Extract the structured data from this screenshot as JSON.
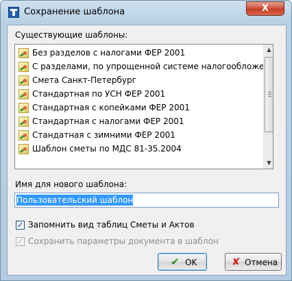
{
  "window": {
    "title": "Сохранение шаблона",
    "close_label": "X"
  },
  "templates_label": "Существующие шаблоны:",
  "templates": [
    "Без разделов с налогами ФЕР 2001",
    "С разделами, по упрощенной системе налогообложения",
    "Смета Санкт-Петербург",
    "Стандартная по УСН ФЕР 2001",
    "Стандартная с копейками ФЕР 2001",
    "Стандартная с налогами ФЕР 2001",
    "Стандатная с зимними ФЕР 2001",
    "Шаблон сметы по МДС 81-35.2004"
  ],
  "item_icon": "template-file-icon",
  "new_name_label": "Имя для нового шаблона:",
  "new_name_value": "Пользовательский шаблон",
  "checkboxes": {
    "remember": {
      "label": "Запомнить вид таблиц Сметы и Актов",
      "checked": true,
      "enabled": true
    },
    "save_params": {
      "label": "Сохранить параметры документа в шаблон",
      "checked": true,
      "enabled": false
    }
  },
  "buttons": {
    "ok": "OK",
    "cancel": "Отмена"
  },
  "colors": {
    "selection": "#3399ff",
    "close_button": "#c43a22",
    "ok_icon": "#2e8f24",
    "cancel_icon": "#cc2a1e"
  }
}
